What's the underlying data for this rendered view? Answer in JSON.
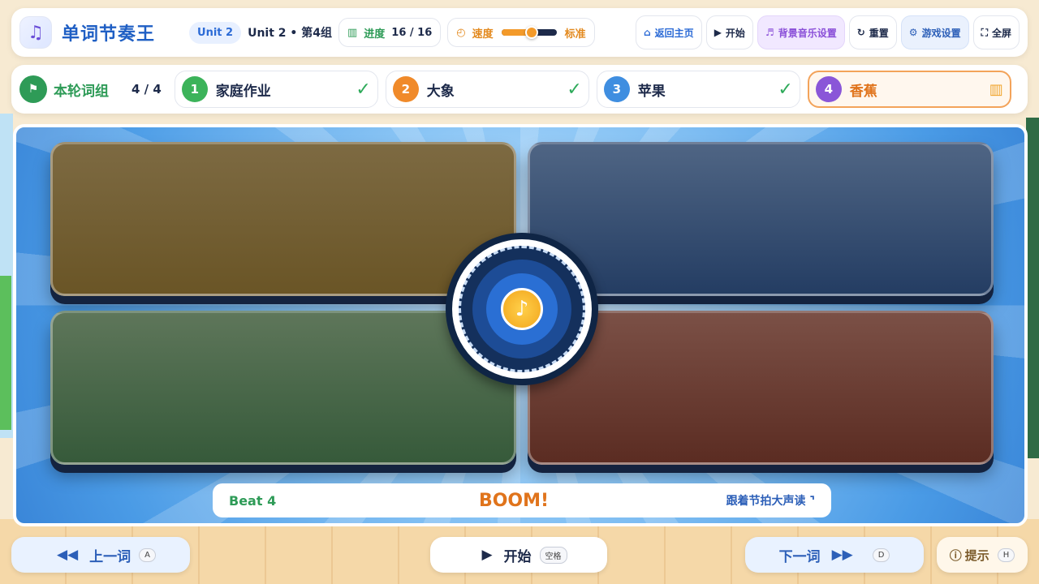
{
  "header": {
    "logo_icon": "music-note-icon",
    "app_title": "单词节奏王",
    "unit_chip": "Unit 2",
    "unit_text": "Unit 2 • 第4组",
    "progress_label": "进度",
    "progress_value": "16 / 16",
    "speed_label": "速度",
    "speed_value": "标准",
    "speed_level": 0.55,
    "buttons": {
      "home": "返回主页",
      "start": "开始",
      "music": "背景音乐设置",
      "reset": "重置",
      "settings": "游戏设置",
      "fullscreen": "全屏"
    }
  },
  "word_group": {
    "title": "本轮词组",
    "count": "4 / 4",
    "words": [
      {
        "num": "1",
        "word": "家庭作业",
        "color": "#3cb35a",
        "done": true
      },
      {
        "num": "2",
        "word": "大象",
        "color": "#f08a2a",
        "done": true
      },
      {
        "num": "3",
        "word": "苹果",
        "color": "#3f8ee0",
        "done": true
      },
      {
        "num": "4",
        "word": "香蕉",
        "color": "#8a56d8",
        "done": false
      }
    ]
  },
  "stage": {
    "beat_label": "Beat 4",
    "beat_word": "BOOM!",
    "beat_hint": "跟着节拍大声读"
  },
  "footer": {
    "prev_label": "上一词",
    "prev_key": "A",
    "start_label": "开始",
    "start_key": "空格",
    "next_label": "下一词",
    "next_key": "D",
    "hint_label": "提示",
    "hint_key": "H"
  },
  "colors": {
    "brand": "#1f5fc4",
    "accent": "#e0741c",
    "success": "#2e9b57"
  }
}
